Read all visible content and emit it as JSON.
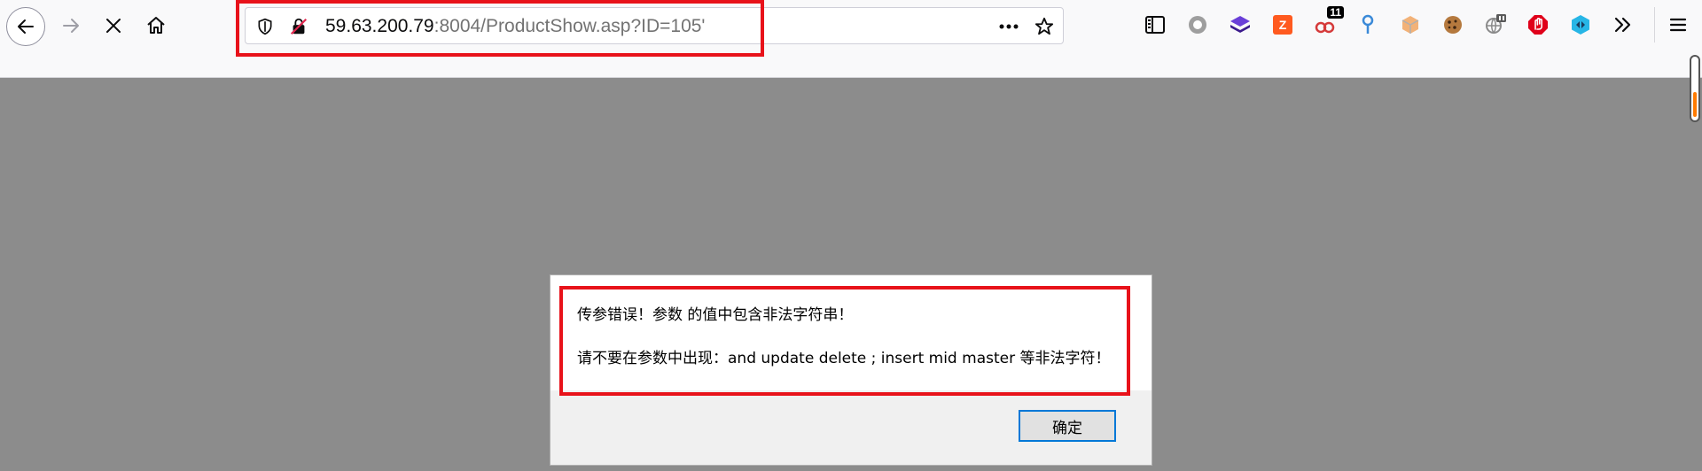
{
  "urlbar": {
    "host": "59.63.200.79",
    "path": ":8004/ProductShow.asp?ID=105'"
  },
  "toolbar": {
    "buttons": [
      "back",
      "forward",
      "stop",
      "home"
    ],
    "extension_icons": [
      "sidebar-icon",
      "circle-extension-icon",
      "stack-extension-icon",
      "zotero-extension-icon",
      "badge-extension-icon",
      "pin-extension-icon",
      "cube-extension-icon",
      "cookie-extension-icon",
      "globe-extension-icon",
      "ublock-extension-icon",
      "vpn-extension-icon",
      "overflow-icon",
      "menu-icon"
    ],
    "badge_count": "11"
  },
  "dialog": {
    "line1": "传参错误！参数  的值中包含非法字符串！",
    "line2": "请不要在参数中出现：and update delete ; insert mid master 等非法字符！",
    "ok_label": "确定"
  },
  "colors": {
    "highlight": "#e8121a",
    "page_overlay": "#8c8c8c",
    "toolbar_bg": "#f9f9fa"
  }
}
